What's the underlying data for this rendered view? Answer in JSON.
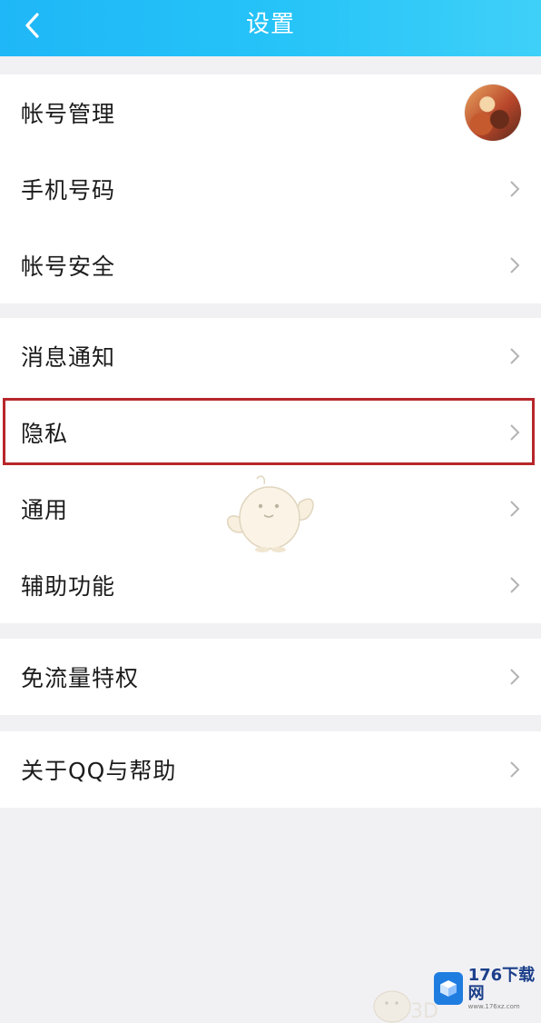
{
  "header": {
    "title": "设置"
  },
  "groups": [
    {
      "items": [
        {
          "label": "帐号管理"
        },
        {
          "label": "手机号码"
        },
        {
          "label": "帐号安全"
        }
      ]
    },
    {
      "items": [
        {
          "label": "消息通知"
        },
        {
          "label": "隐私"
        },
        {
          "label": "通用"
        },
        {
          "label": "辅助功能"
        }
      ]
    },
    {
      "items": [
        {
          "label": "免流量特权"
        }
      ]
    },
    {
      "items": [
        {
          "label": "关于QQ与帮助"
        }
      ]
    }
  ],
  "watermark": {
    "brand": "176下载网",
    "domain": "www.176xz.com"
  },
  "colors": {
    "header_start": "#1fb7f7",
    "header_end": "#3fd0f8",
    "highlight": "#b7262a"
  },
  "icons": {
    "back": "chevron-left-icon",
    "row": "chevron-right-icon"
  }
}
